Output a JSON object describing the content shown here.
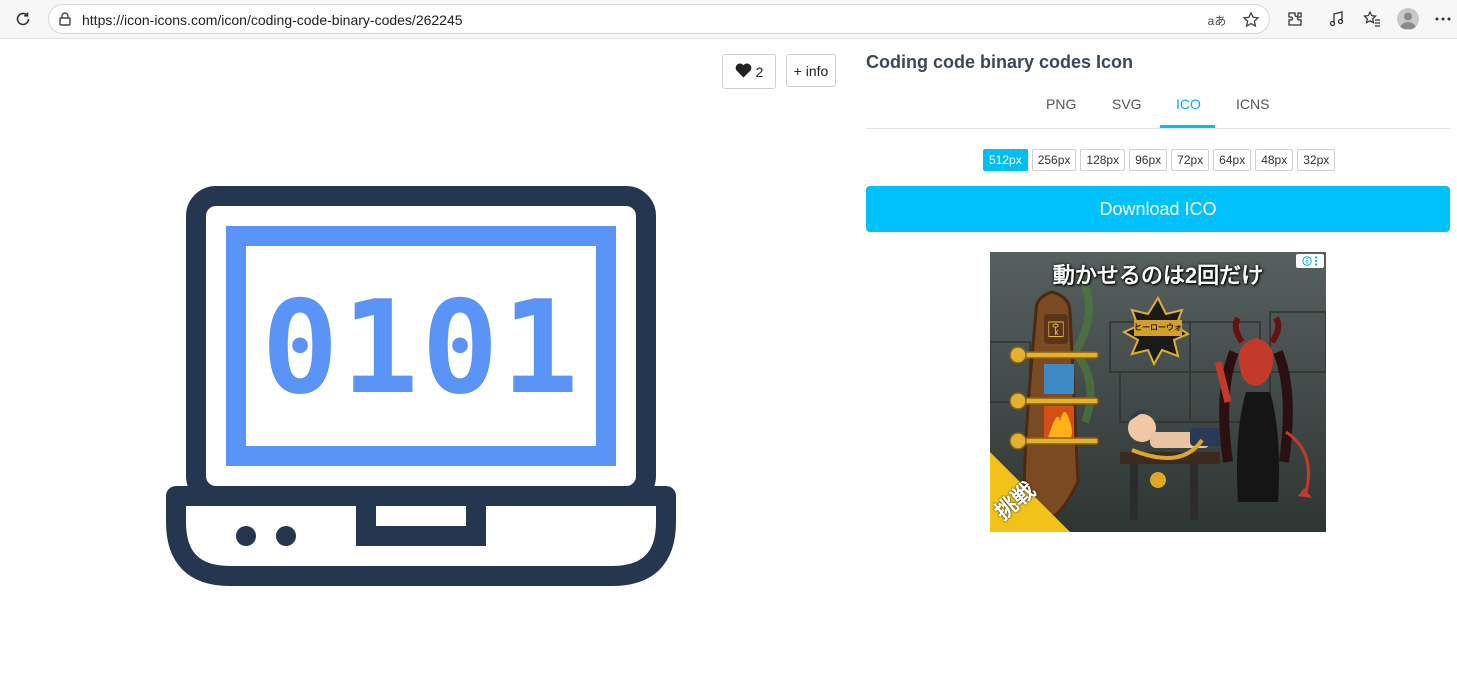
{
  "browser": {
    "url": "https://icon-icons.com/icon/coding-code-binary-codes/262245",
    "translate_label": "aあ"
  },
  "preview": {
    "digits": [
      "0",
      "1",
      "0",
      "1"
    ],
    "frame_color": "#253750",
    "screen_color": "#5b94f7"
  },
  "actions": {
    "like_count": "2",
    "info_label": "+ info"
  },
  "panel": {
    "title": "Coding code binary codes Icon",
    "tabs": [
      {
        "label": "PNG"
      },
      {
        "label": "SVG"
      },
      {
        "label": "ICO",
        "active": true
      },
      {
        "label": "ICNS"
      }
    ],
    "sizes": [
      "512px",
      "256px",
      "128px",
      "96px",
      "72px",
      "64px",
      "48px",
      "32px"
    ],
    "selected_size": "512px",
    "download_label": "Download ICO",
    "accent": "#00c2fb"
  },
  "ad": {
    "headline": "動かせるのは2回だけ",
    "logo_text": "ヒーローウォーズ",
    "corner_text": "挑戦"
  }
}
